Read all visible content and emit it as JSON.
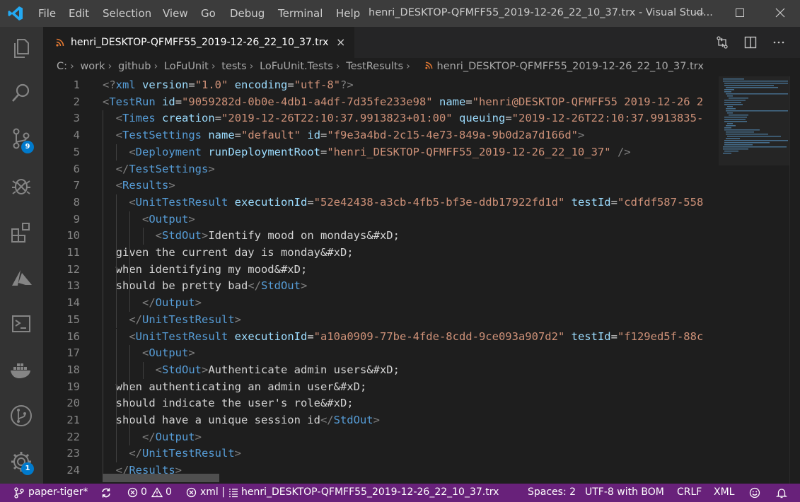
{
  "titlebar": {
    "menus": [
      "File",
      "Edit",
      "Selection",
      "View",
      "Go",
      "Debug",
      "Terminal",
      "Help"
    ],
    "window_title": "henri_DESKTOP-QFMFF55_2019-12-26_22_10_37.trx - Visual Stud..."
  },
  "activitybar": {
    "items": [
      "explorer-icon",
      "search-icon",
      "source-control-icon",
      "debug-icon",
      "extensions-icon",
      "azure-icon",
      "remote-icon",
      "docker-icon",
      "git-graph-icon",
      "settings-gear-icon"
    ],
    "source_control_badge": "9",
    "settings_badge": "1"
  },
  "tab": {
    "label": "henri_DESKTOP-QFMFF55_2019-12-26_22_10_37.trx",
    "close": "×"
  },
  "breadcrumb": [
    "C:",
    "work",
    "github",
    "LoFuUnit",
    "tests",
    "LoFuUnit.Tests",
    "TestResults",
    "henri_DESKTOP-QFMFF55_2019-12-26_22_10_37.trx"
  ],
  "editor": {
    "line_numbers": [
      "1",
      "2",
      "3",
      "4",
      "5",
      "6",
      "7",
      "8",
      "9",
      "10",
      "11",
      "12",
      "13",
      "14",
      "15",
      "16",
      "17",
      "18",
      "19",
      "20",
      "21",
      "22",
      "23",
      "24"
    ],
    "lines": [
      "<?xml version=\"1.0\" encoding=\"utf-8\"?>",
      "<TestRun id=\"9059282d-0b0e-4db1-a4df-7d35fe233e98\" name=\"henri@DESKTOP-QFMFF55 2019-12-26 2",
      "  <Times creation=\"2019-12-26T22:10:37.9913823+01:00\" queuing=\"2019-12-26T22:10:37.9913835-",
      "  <TestSettings name=\"default\" id=\"f9e3a4bd-2c15-4e73-849a-9b0d2a7d166d\">",
      "    <Deployment runDeploymentRoot=\"henri_DESKTOP-QFMFF55_2019-12-26_22_10_37\" />",
      "  </TestSettings>",
      "  <Results>",
      "    <UnitTestResult executionId=\"52e42438-a3cb-4fb5-bf3e-ddb17922fd1d\" testId=\"cdfdf587-558",
      "      <Output>",
      "        <StdOut>Identify mood on mondays&#xD;",
      "  given the current day is monday&#xD;",
      "  when identifying my mood&#xD;",
      "  should be pretty bad</StdOut>",
      "      </Output>",
      "    </UnitTestResult>",
      "    <UnitTestResult executionId=\"a10a0909-77be-4fde-8cdd-9ce093a907d2\" testId=\"f129ed5f-88c",
      "      <Output>",
      "        <StdOut>Authenticate admin users&#xD;",
      "  when authenticating an admin user&#xD;",
      "  should indicate the user's role&#xD;",
      "  should have a unique session id</StdOut>",
      "      </Output>",
      "    </UnitTestResult>",
      "  </Results>"
    ]
  },
  "statusbar": {
    "branch": "paper-tiger*",
    "errors": "0",
    "warnings": "0",
    "xml_label": "xml |",
    "file": "henri_DESKTOP-QFMFF55_2019-12-26_22_10_37.trx",
    "spaces": "Spaces: 2",
    "encoding": "UTF-8 with BOM",
    "eol": "CRLF",
    "language": "XML"
  },
  "colors": {
    "statusbar": "#68217a",
    "titlebar": "#3c3c3c",
    "activitybar": "#333333",
    "editor": "#1e1e1e",
    "tag": "#569cd6",
    "attribute": "#9cdcfe",
    "string": "#ce9178"
  }
}
